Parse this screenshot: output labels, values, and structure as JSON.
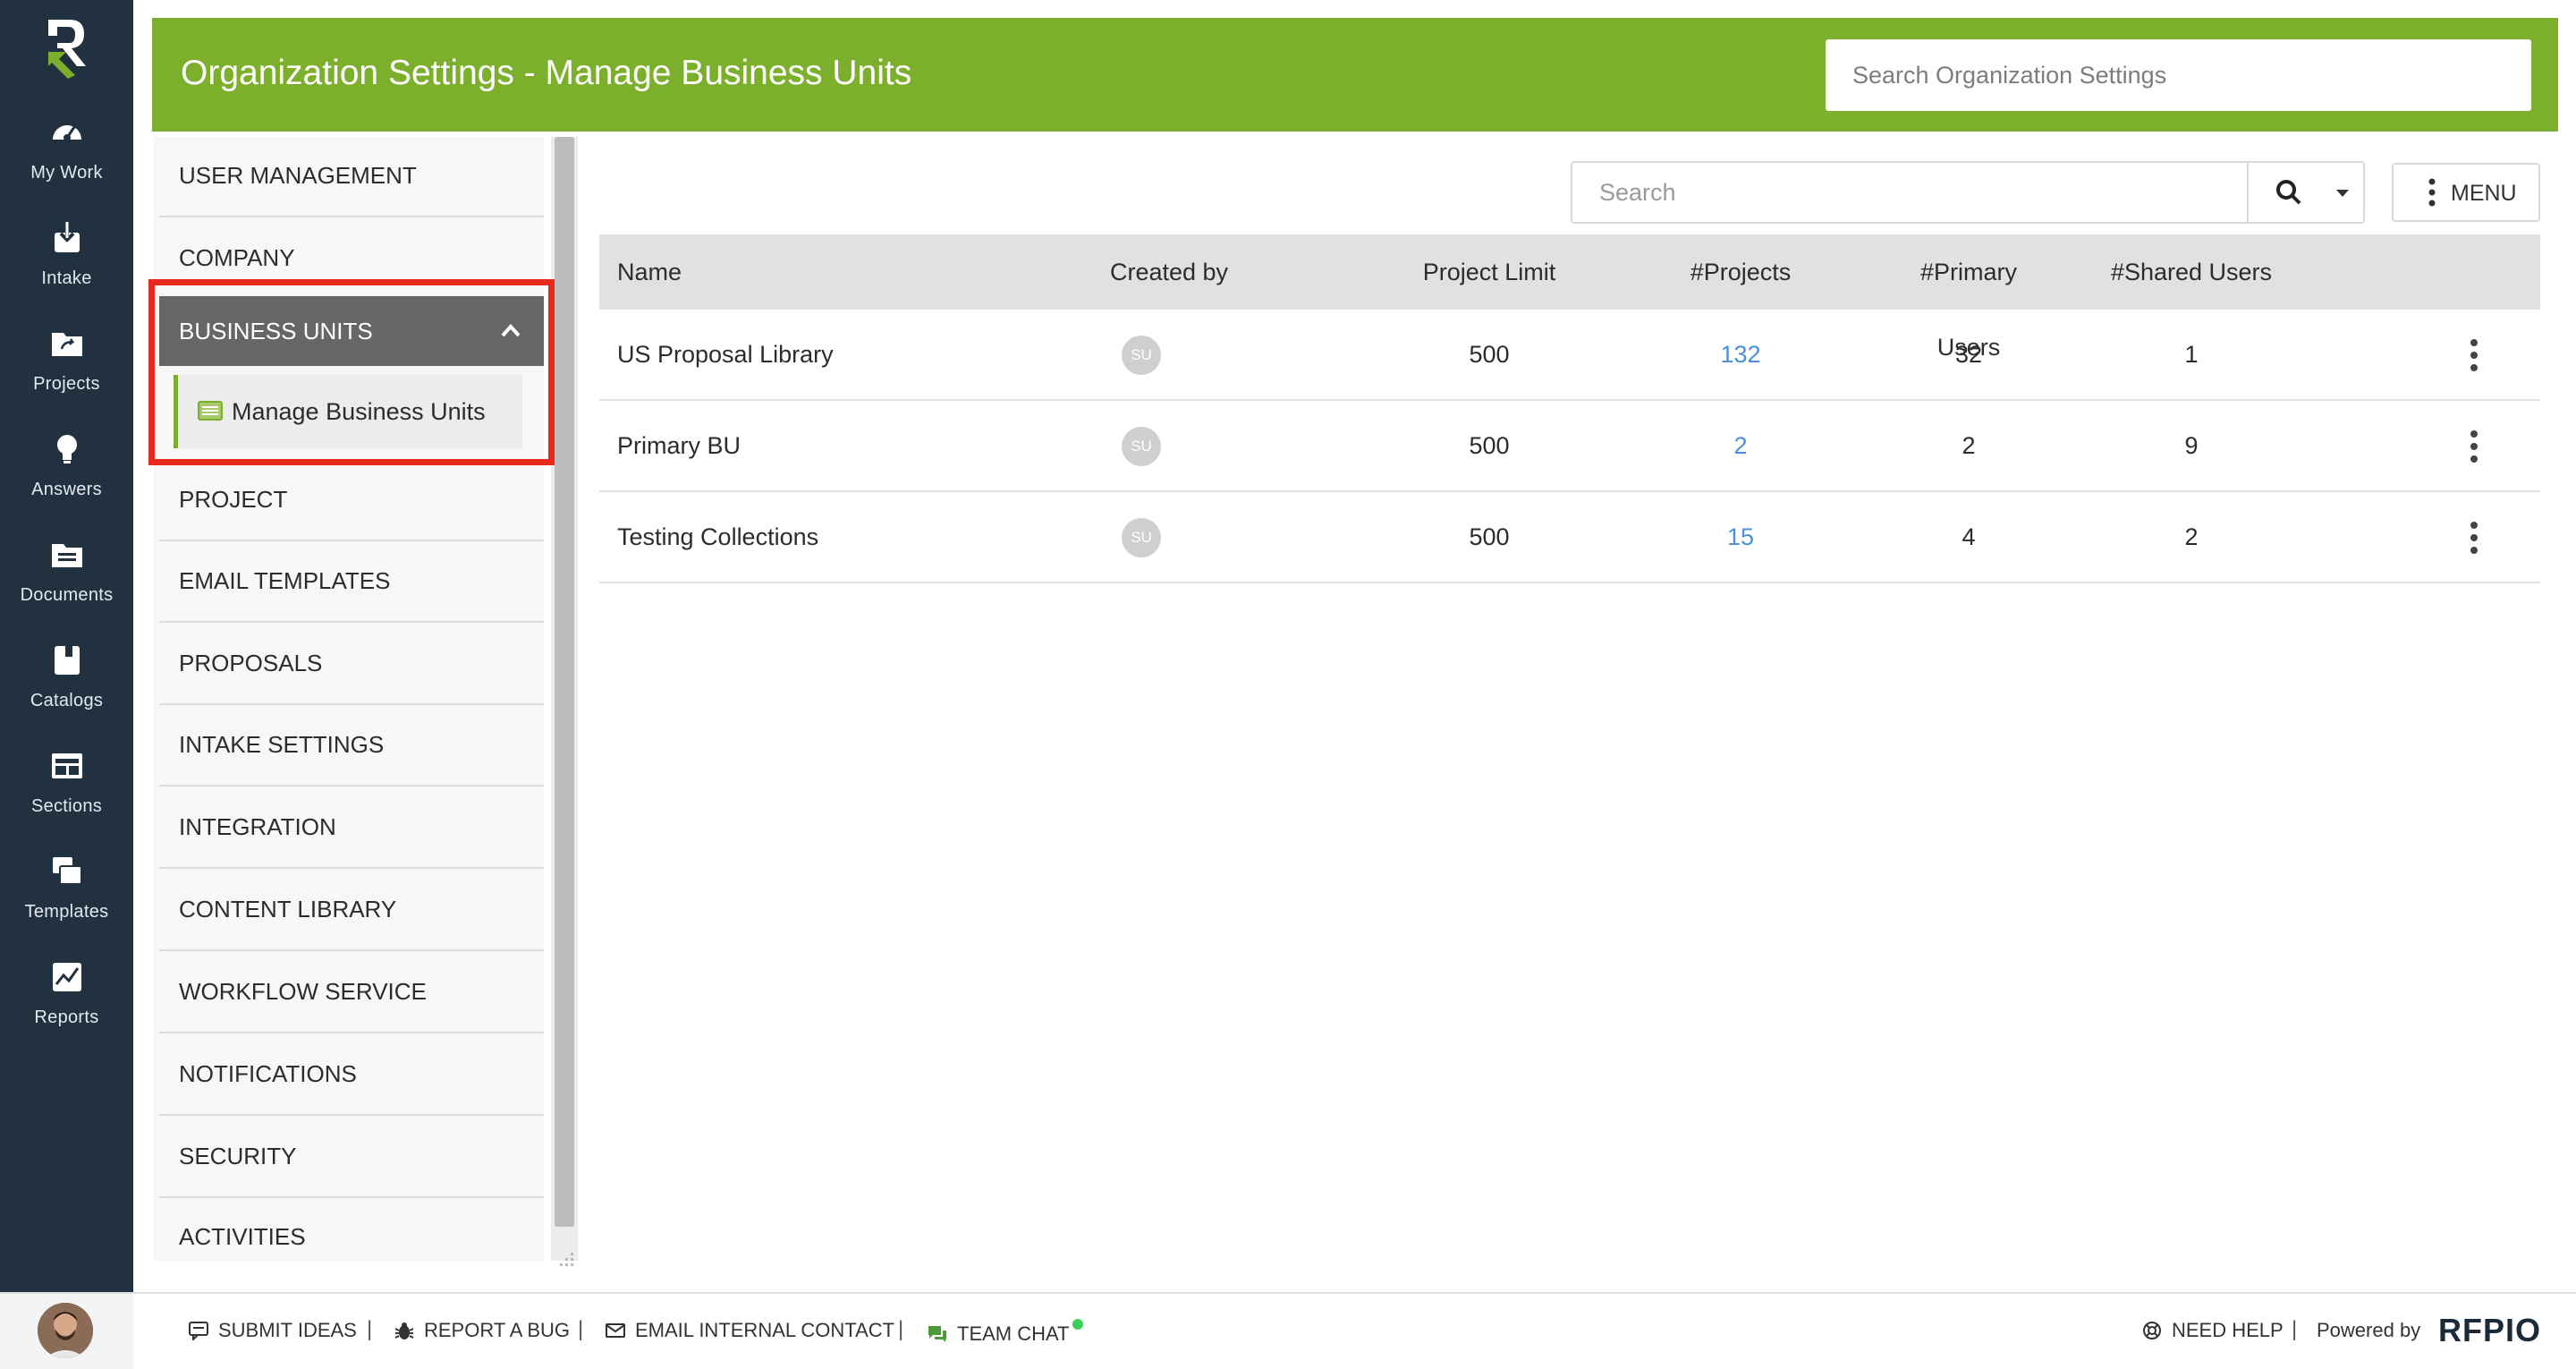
{
  "rail": {
    "items": [
      {
        "label": "My Work",
        "icon": "dashboard-icon"
      },
      {
        "label": "Intake",
        "icon": "intake-icon"
      },
      {
        "label": "Projects",
        "icon": "projects-folder-icon"
      },
      {
        "label": "Answers",
        "icon": "lightbulb-icon"
      },
      {
        "label": "Documents",
        "icon": "documents-icon"
      },
      {
        "label": "Catalogs",
        "icon": "catalogs-icon"
      },
      {
        "label": "Sections",
        "icon": "sections-icon"
      },
      {
        "label": "Templates",
        "icon": "templates-icon"
      },
      {
        "label": "Reports",
        "icon": "reports-icon"
      }
    ]
  },
  "header": {
    "title": "Organization Settings - Manage Business Units",
    "search_placeholder": "Search Organization Settings",
    "bg_color": "#7cb02c"
  },
  "settings_nav": {
    "items": [
      {
        "label": "USER MANAGEMENT"
      },
      {
        "label": "COMPANY"
      },
      {
        "label": "BUSINESS UNITS",
        "active": true,
        "expanded": true
      },
      {
        "label": "PROJECT"
      },
      {
        "label": "EMAIL TEMPLATES"
      },
      {
        "label": "PROPOSALS"
      },
      {
        "label": "INTAKE SETTINGS"
      },
      {
        "label": "INTEGRATION"
      },
      {
        "label": "CONTENT LIBRARY"
      },
      {
        "label": "WORKFLOW SERVICE"
      },
      {
        "label": "NOTIFICATIONS"
      },
      {
        "label": "SECURITY"
      },
      {
        "label": "ACTIVITIES"
      }
    ],
    "sub_item": {
      "label": "Manage Business Units"
    },
    "highlight_color": "#e8291c"
  },
  "toolbar": {
    "search_placeholder": "Search",
    "menu_label": "MENU"
  },
  "table": {
    "headers": {
      "name": "Name",
      "created_by": "Created by",
      "project_limit": "Project Limit",
      "projects": "#Projects",
      "primary_users": "#Primary Users",
      "shared_users": "#Shared Users"
    },
    "rows": [
      {
        "name": "US Proposal Library",
        "created_by": "SU",
        "project_limit": "500",
        "projects": "132",
        "primary_users": "32",
        "shared_users": "1"
      },
      {
        "name": "Primary BU",
        "created_by": "SU",
        "project_limit": "500",
        "projects": "2",
        "primary_users": "2",
        "shared_users": "9"
      },
      {
        "name": "Testing Collections",
        "created_by": "SU",
        "project_limit": "500",
        "projects": "15",
        "primary_users": "4",
        "shared_users": "2"
      }
    ],
    "link_color": "#4a90d9"
  },
  "footer": {
    "submit_ideas": "SUBMIT IDEAS",
    "report_bug": "REPORT A BUG",
    "email_contact": "EMAIL INTERNAL CONTACT",
    "team_chat": "TEAM CHAT",
    "need_help": "NEED HELP",
    "powered_by": "Powered by",
    "brand": "RFPIO",
    "separator": "|"
  }
}
